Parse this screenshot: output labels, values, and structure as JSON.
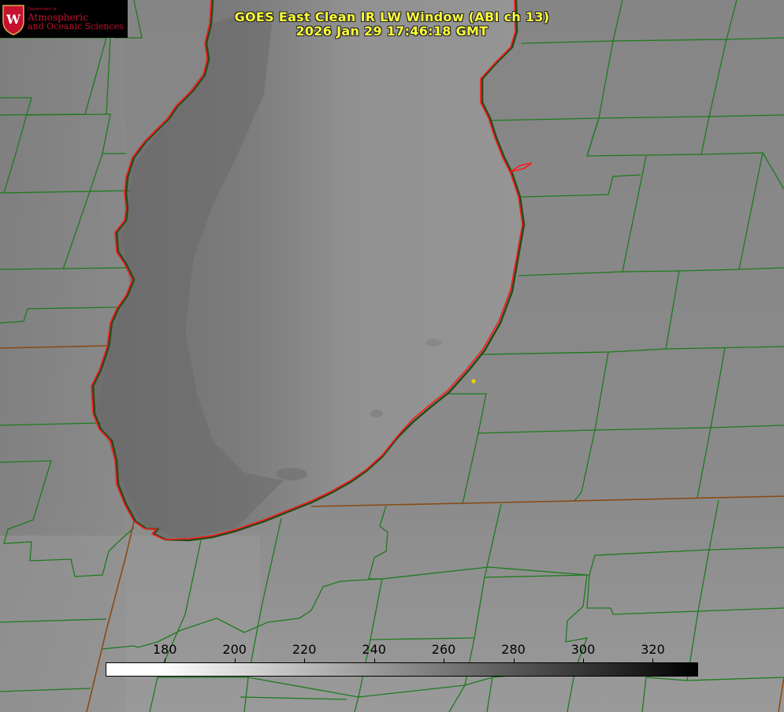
{
  "header": {
    "title_line1": "GOES East Clean IR LW Window (ABI ch 13)",
    "title_line2": "2026 Jan 29 17:46:18 GMT",
    "title_color": "#ffff3a"
  },
  "logo": {
    "department": "Department of",
    "line1": "Atmospheric",
    "line2": "and Oceanic Sciences",
    "seal_icon": "uw-crest-icon",
    "accent_color": "#c5102f"
  },
  "colorbar": {
    "ticks": [
      "180",
      "200",
      "220",
      "240",
      "260",
      "280",
      "300",
      "320"
    ],
    "tick_values": [
      180,
      200,
      220,
      240,
      260,
      280,
      300,
      320
    ],
    "range": [
      163,
      333
    ],
    "gradient": "white-to-black"
  },
  "map": {
    "county_color": "#1e7a1e",
    "state_color": "#8a4a14",
    "coast_color": "#ff1a1a",
    "marker_color": "#e6d200"
  }
}
